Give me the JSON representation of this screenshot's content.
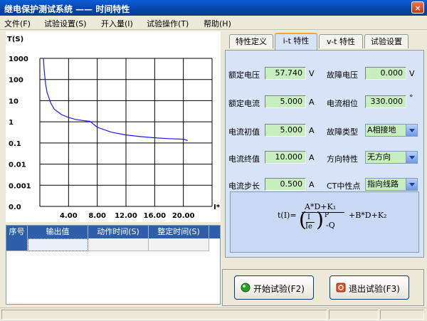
{
  "window": {
    "title": "继电保护测试系统 —— 时间特性",
    "close_label": "×"
  },
  "menu": [
    {
      "label": "文件(F)"
    },
    {
      "label": "试验设置(S)"
    },
    {
      "label": "开入量(I)"
    },
    {
      "label": "试验操作(T)"
    },
    {
      "label": "帮助(H)"
    }
  ],
  "chart_data": {
    "type": "line",
    "xlabel": "I*",
    "ylabel": "T(S)",
    "x_ticks": [
      "4.00",
      "8.00",
      "12.00",
      "16.00",
      "20.00"
    ],
    "y_ticks": [
      "1000",
      "100",
      "10",
      "1",
      "0.1",
      "0.01",
      "0.001",
      "0.0"
    ],
    "x_range": [
      0,
      24
    ],
    "y_scale": "log",
    "grid": true,
    "series": [
      {
        "values_x": [
          0.5,
          0.6,
          0.8,
          1.0,
          1.5,
          2.0,
          3.0,
          4.0,
          5.0,
          6.0,
          7.0,
          8.0,
          10.0,
          12.0,
          14.0,
          16.0,
          18.0,
          20.0,
          20.6
        ],
        "values_y": [
          1000,
          300,
          60,
          25,
          8,
          4,
          2.2,
          1.6,
          1.3,
          1.15,
          1.05,
          0.55,
          0.32,
          0.24,
          0.2,
          0.175,
          0.16,
          0.15,
          0.13
        ]
      }
    ],
    "color": "#1a1aee"
  },
  "table": {
    "headers": [
      "序号",
      "输出值",
      "动作时间(S)",
      "整定时间(S)"
    ],
    "rows": [
      [
        "",
        "",
        "",
        ""
      ]
    ]
  },
  "tabs": [
    {
      "label": "特性定义"
    },
    {
      "label": "i-t 特性"
    },
    {
      "label": "v-t 特性"
    },
    {
      "label": "试验设置"
    }
  ],
  "fields": {
    "rated_voltage": {
      "label": "额定电压",
      "value": "57.740",
      "unit": "V"
    },
    "fault_voltage": {
      "label": "故障电压",
      "value": "0.000",
      "unit": "V"
    },
    "rated_current": {
      "label": "额定电流",
      "value": "5.000",
      "unit": "A"
    },
    "current_phase": {
      "label": "电流相位",
      "value": "330.000",
      "unit": "°"
    },
    "current_start": {
      "label": "电流初值",
      "value": "5.000",
      "unit": "A"
    },
    "fault_type": {
      "label": "故障类型",
      "value": "A相接地"
    },
    "current_end": {
      "label": "电流终值",
      "value": "10.000",
      "unit": "A"
    },
    "direction": {
      "label": "方向特性",
      "value": "无方向"
    },
    "current_step": {
      "label": "电流步长",
      "value": "0.500",
      "unit": "A"
    },
    "ct_neutral": {
      "label": "CT中性点",
      "value": "指向线路"
    }
  },
  "formula": {
    "lhs": "t(I)=",
    "numerator": "A*D+K₁",
    "frac_i": "I",
    "frac_ie": "Ie",
    "power": "P",
    "minus_q": "-Q",
    "rhs": "+B*D+K₂"
  },
  "buttons": {
    "start": "开始试验(F2)",
    "exit": "退出试验(F3)"
  },
  "colors": {
    "title_blue": "#0a5ed8",
    "panel_bg": "#d7e4f7",
    "value_green": "#c7eebf",
    "table_header": "#2e5ea8"
  }
}
